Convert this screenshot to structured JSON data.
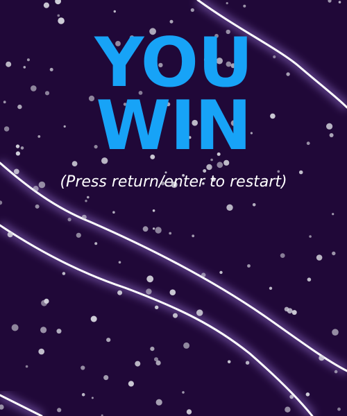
{
  "colors": {
    "background": "#200838",
    "title": "#17a3f7",
    "hint_text": "#ffffff",
    "snow": "#d8d8e0",
    "streak": "#ffffff",
    "streak_glow": "#9a78d8"
  },
  "win_screen": {
    "title_line_1": "YOU",
    "title_line_2": "WIN",
    "restart_hint": "(Press return/enter to restart)"
  }
}
